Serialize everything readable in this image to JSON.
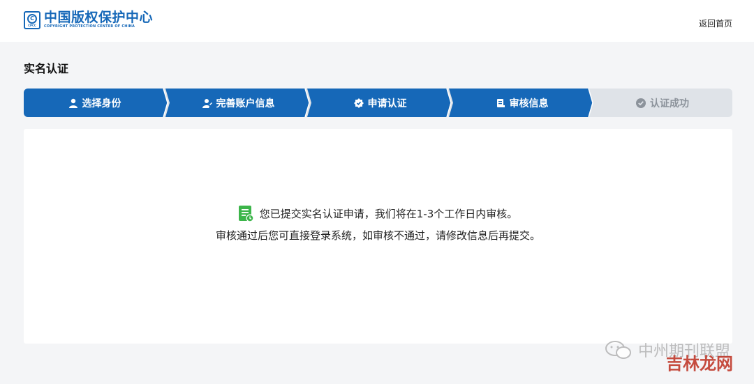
{
  "header": {
    "logo_cn": "中国版权保护中心",
    "logo_en": "COPYRIGHT PROTECTION CENTER OF CHINA",
    "logo_mark": "CPCC",
    "home_link": "返回首页"
  },
  "page": {
    "title": "实名认证"
  },
  "steps": [
    {
      "label": "选择身份",
      "icon": "user-icon",
      "state": "done"
    },
    {
      "label": "完善账户信息",
      "icon": "user-edit-icon",
      "state": "done"
    },
    {
      "label": "申请认证",
      "icon": "badge-check-icon",
      "state": "done"
    },
    {
      "label": "审核信息",
      "icon": "document-icon",
      "state": "current"
    },
    {
      "label": "认证成功",
      "icon": "check-circle-icon",
      "state": "pending"
    }
  ],
  "message": {
    "line1": "您已提交实名认证申请，我们将在1-3个工作日内审核。",
    "line2": "审核通过后您可直接登录系统，如审核不通过，请修改信息后再提交。"
  },
  "watermark": {
    "text": "中州期刊联盟",
    "overlay": "吉林龙网"
  },
  "colors": {
    "primary": "#1668b8",
    "inactive_step": "#dfe3e8",
    "background": "#f4f5f7"
  }
}
